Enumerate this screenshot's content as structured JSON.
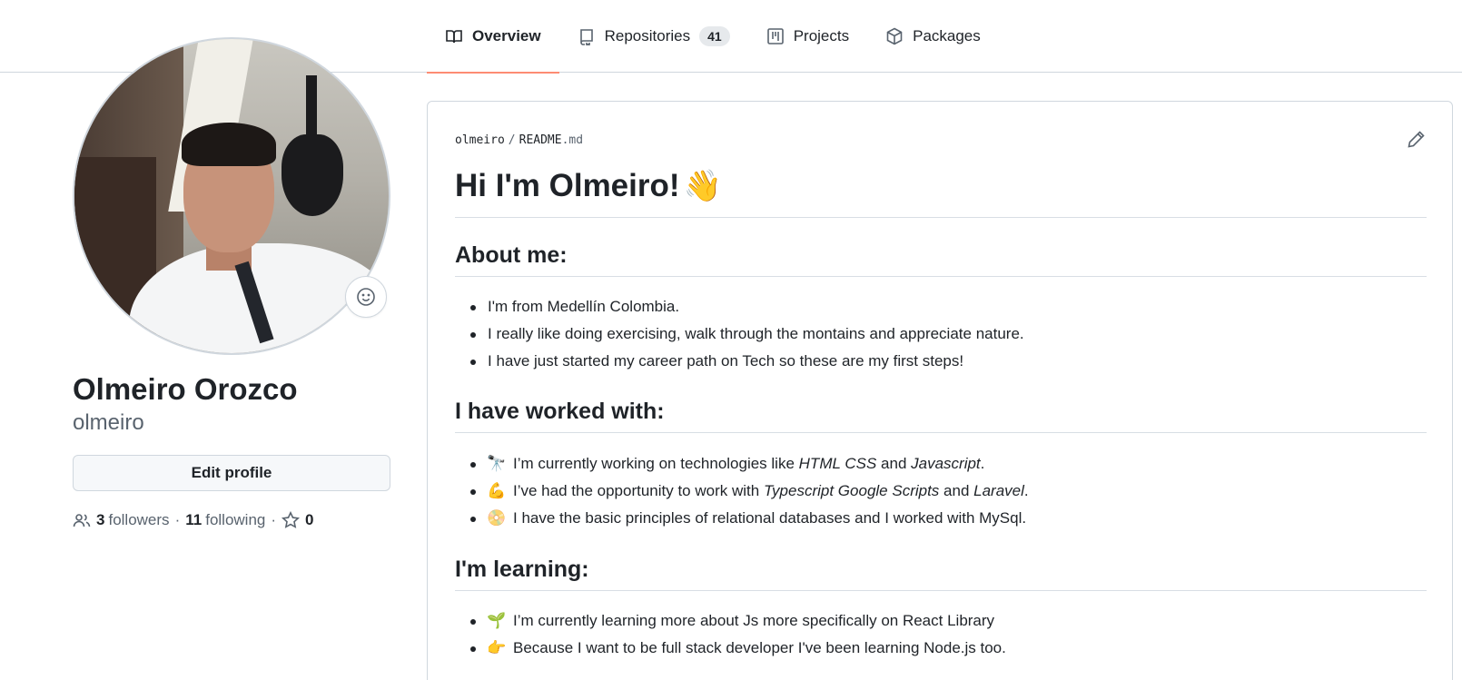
{
  "nav": {
    "tabs": [
      {
        "label": "Overview",
        "icon": "book-icon",
        "active": true
      },
      {
        "label": "Repositories",
        "icon": "repo-icon",
        "count": "41"
      },
      {
        "label": "Projects",
        "icon": "project-icon"
      },
      {
        "label": "Packages",
        "icon": "package-icon"
      }
    ]
  },
  "profile": {
    "name": "Olmeiro Orozco",
    "login": "olmeiro",
    "edit_label": "Edit profile",
    "followers_count": "3",
    "followers_label": "followers",
    "following_count": "11",
    "following_label": "following",
    "stars_count": "0",
    "separator": "·"
  },
  "readme": {
    "owner": "olmeiro",
    "file_name": "README",
    "file_ext": ".md",
    "path_sep": "/",
    "title": "Hi I'm Olmeiro!",
    "title_emoji": "👋",
    "sections": [
      {
        "heading": "About me:",
        "items": [
          "I'm from Medellín Colombia.",
          "I really like doing exercising, walk through the montains and appreciate nature.",
          "I have just started my career path on Tech so these are my first steps!"
        ]
      },
      {
        "heading": "I have worked with:",
        "items": [
          {
            "emoji": "🔭",
            "pre": "I’m currently working on technologies like ",
            "em1": "HTML CSS",
            "mid": " and ",
            "em2": "Javascript",
            "post": "."
          },
          {
            "emoji": "💪",
            "pre": "I’ve had the opportunity to work with ",
            "em1": "Typescript Google Scripts",
            "mid": " and ",
            "em2": "Laravel",
            "post": "."
          },
          {
            "emoji": "📀",
            "text": "I have the basic principles of relational databases and I worked with MySql."
          }
        ]
      },
      {
        "heading": "I'm learning:",
        "items": [
          {
            "emoji": "🌱",
            "text": "I’m currently learning more about Js more specifically on React Library"
          },
          {
            "emoji": "👉",
            "text": "Because I want to be full stack developer I've been learning Node.js too."
          }
        ]
      }
    ]
  },
  "colors": {
    "accent_underline": "#fd8c73",
    "text": "#1f2328",
    "muted": "#59636e",
    "border": "#d0d7de"
  }
}
